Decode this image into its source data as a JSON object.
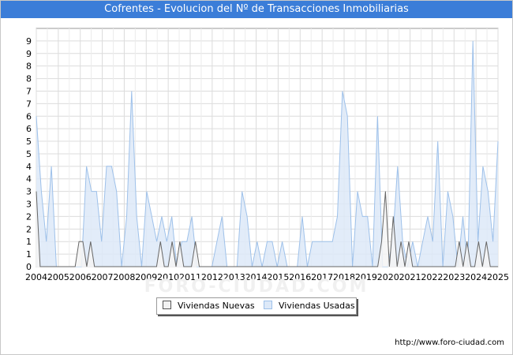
{
  "header": {
    "title": "Cofrentes - Evolucion del Nº de Transacciones Inmobiliarias"
  },
  "footer": {
    "source": "http://www.foro-ciudad.com",
    "watermark": "FORO-CIUDAD.COM"
  },
  "legend": [
    {
      "label": "Viviendas Nuevas",
      "color": "#f2f2f2",
      "stroke": "#555555"
    },
    {
      "label": "Viviendas Usadas",
      "color": "#dde9f8",
      "stroke": "#9ec1ea"
    }
  ],
  "chart_data": {
    "type": "area",
    "title": "Cofrentes - Evolucion del Nº de Transacciones Inmobiliarias",
    "xlabel": "",
    "ylabel": "",
    "x_ticks": [
      "2004",
      "2005",
      "2006",
      "2007",
      "2008",
      "2009",
      "2010",
      "2011",
      "2012",
      "2013",
      "2014",
      "2015",
      "2016",
      "2017",
      "2018",
      "2019",
      "2020",
      "2021",
      "2022",
      "2023",
      "2024",
      "2025"
    ],
    "y_ticks": [
      "0",
      "1",
      "1",
      "2",
      "2",
      "3",
      "3",
      "4",
      "4",
      "5",
      "5",
      "6",
      "6",
      "7",
      "7",
      "8",
      "8",
      "9",
      "9"
    ],
    "ylim": [
      0,
      9.5
    ],
    "grid": true,
    "legend_position": "bottom",
    "series": [
      {
        "name": "Viviendas Nuevas",
        "values": [
          3,
          0,
          0,
          0,
          0,
          0,
          0,
          0,
          0,
          0,
          0,
          1,
          1,
          0,
          1,
          0,
          0,
          0,
          0,
          0,
          0,
          0,
          0,
          0,
          0,
          0,
          0,
          0,
          0,
          0,
          0,
          0,
          1,
          0,
          0,
          1,
          0,
          1,
          0,
          0,
          0,
          1,
          0,
          0,
          0,
          0,
          0,
          0,
          0,
          0,
          0,
          0,
          0,
          0,
          0,
          0,
          0,
          0,
          0,
          0,
          0,
          0,
          0,
          0,
          0,
          0,
          0,
          0,
          0,
          0,
          0,
          0,
          0,
          0,
          0,
          0,
          0,
          0,
          0,
          0,
          0,
          0,
          0,
          0,
          0,
          0,
          0,
          0,
          0,
          1,
          3,
          0,
          2,
          0,
          1,
          0,
          1,
          0,
          0,
          0,
          0,
          0,
          0,
          0,
          0,
          0,
          0,
          0,
          0,
          1,
          0,
          1,
          0,
          0,
          1,
          0,
          1,
          0,
          0,
          0
        ]
      },
      {
        "name": "Viviendas Usadas",
        "values": [
          6,
          3,
          1,
          4,
          0,
          0,
          0,
          0,
          0,
          0,
          4,
          3,
          3,
          1,
          4,
          4,
          3,
          0,
          2,
          7,
          2,
          0,
          3,
          2,
          1,
          2,
          1,
          2,
          0,
          1,
          1,
          2,
          0,
          0,
          0,
          0,
          1,
          2,
          0,
          0,
          0,
          3,
          2,
          0,
          1,
          0,
          1,
          1,
          0,
          1,
          0,
          0,
          0,
          2,
          0,
          1,
          1,
          1,
          1,
          1,
          2,
          7,
          6,
          0,
          3,
          2,
          2,
          0,
          6,
          0,
          0,
          1,
          4,
          1,
          0,
          1,
          0,
          1,
          2,
          1,
          5,
          0,
          3,
          2,
          0,
          2,
          0,
          9,
          1,
          4,
          3,
          1,
          5
        ]
      }
    ]
  }
}
